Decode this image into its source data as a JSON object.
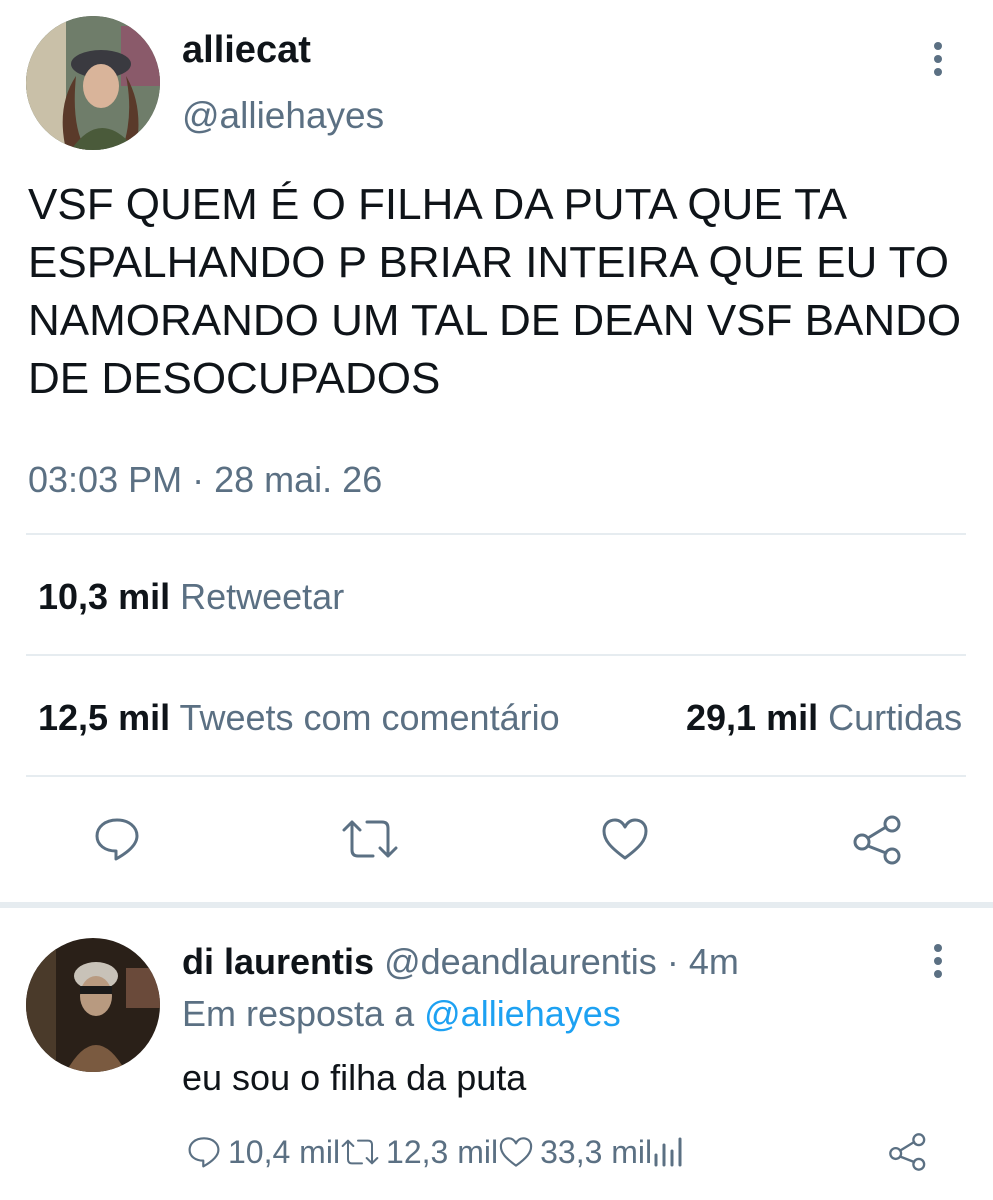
{
  "main_tweet": {
    "display_name": "alliecat",
    "handle": "@alliehayes",
    "text": "VSF QUEM É O FILHA DA PUTA QUE TA ESPALHANDO P BRIAR INTEIRA QUE EU TO NAMORANDO UM TAL DE DEAN VSF BANDO DE DESOCUPADOS",
    "time": "03:03 PM",
    "separator": "·",
    "date": "28 mai. 26",
    "retweets": {
      "count": "10,3 mil",
      "label": "Retweetar"
    },
    "quotes": {
      "count": "12,5 mil",
      "label": "Tweets com comentário"
    },
    "likes": {
      "count": "29,1 mil",
      "label": "Curtidas"
    },
    "actions": [
      "reply-icon",
      "retweet-icon",
      "like-icon",
      "share-icon"
    ]
  },
  "reply": {
    "display_name": "di laurentis",
    "handle": "@deandlaurentis",
    "time_sep": "·",
    "time_ago": "4m",
    "reply_prefix": "Em resposta a",
    "reply_to": "@alliehayes",
    "text": "eu sou o filha da puta",
    "reply_count": "10,4 mil",
    "retweet_count": "12,3 mil",
    "like_count": "33,3 mil"
  },
  "colors": {
    "accent": "#1da1f2",
    "muted": "#5b7083",
    "text": "#0f1419",
    "divider": "#e6ecf0"
  }
}
